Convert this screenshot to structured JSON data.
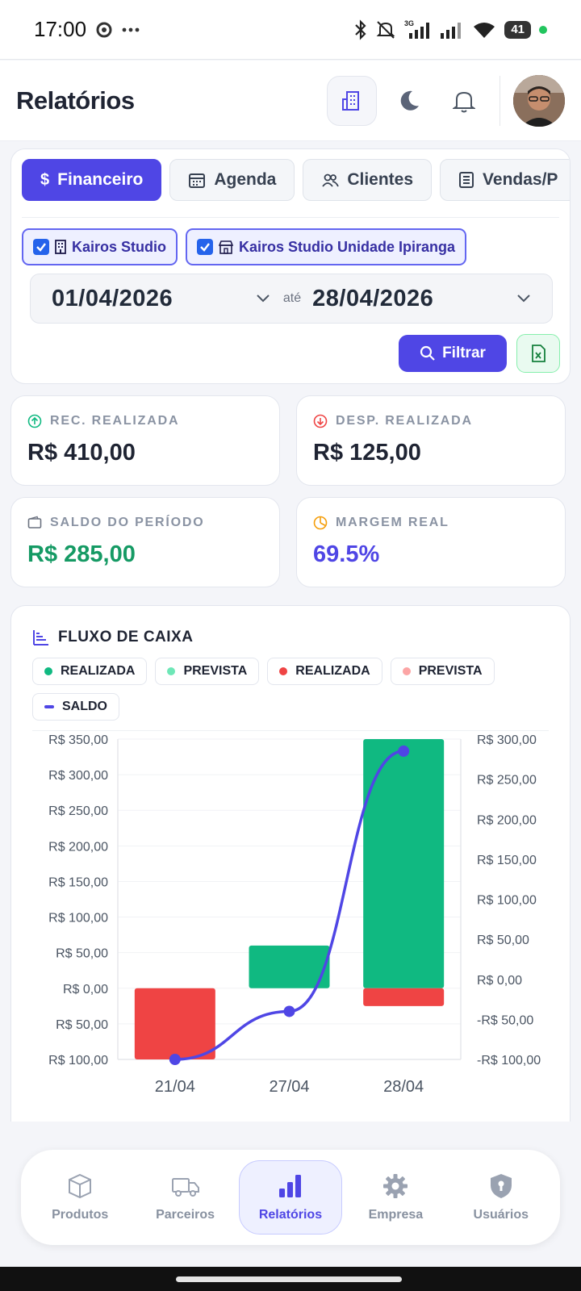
{
  "status_bar": {
    "time": "17:00",
    "battery": "41",
    "network": "3G"
  },
  "header": {
    "title": "Relatórios"
  },
  "tabs": [
    {
      "label": "Financeiro",
      "icon": "dollar-icon"
    },
    {
      "label": "Agenda",
      "icon": "calendar-icon"
    },
    {
      "label": "Clientes",
      "icon": "users-icon"
    },
    {
      "label": "Vendas/P",
      "icon": "receipt-icon"
    }
  ],
  "filters": {
    "units": [
      {
        "label": "Kairos Studio",
        "checked": true,
        "icon": "building-icon"
      },
      {
        "label": "Kairos Studio Unidade Ipiranga",
        "checked": true,
        "icon": "store-icon"
      }
    ],
    "date_from": "01/04/2026",
    "date_separator": "até",
    "date_to": "28/04/2026",
    "filter_button": "Filtrar"
  },
  "kpis": [
    {
      "label": "REC. REALIZADA",
      "value": "R$ 410,00",
      "icon": "arrow-up-circle-icon"
    },
    {
      "label": "DESP. REALIZADA",
      "value": "R$ 125,00",
      "icon": "arrow-down-circle-icon"
    },
    {
      "label": "SALDO DO PERÍODO",
      "value": "R$ 285,00",
      "icon": "wallet-icon"
    },
    {
      "label": "MARGEM REAL",
      "value": "69.5%",
      "icon": "pie-chart-icon"
    }
  ],
  "chart_card": {
    "title": "FLUXO DE CAIXA",
    "legend": [
      {
        "label": "REALIZADA",
        "color": "#10b981",
        "shape": "dot"
      },
      {
        "label": "PREVISTA",
        "color": "#6ee7b7",
        "shape": "dot"
      },
      {
        "label": "REALIZADA",
        "color": "#ef4444",
        "shape": "dot"
      },
      {
        "label": "PREVISTA",
        "color": "#fca5a5",
        "shape": "dot"
      },
      {
        "label": "SALDO",
        "color": "#4f46e5",
        "shape": "line"
      }
    ]
  },
  "chart_data": {
    "type": "bar",
    "title": "FLUXO DE CAIXA",
    "categories": [
      "21/04",
      "27/04",
      "28/04"
    ],
    "y_left_ticks": [
      "R$ 350,00",
      "R$ 300,00",
      "R$ 250,00",
      "R$ 200,00",
      "R$ 150,00",
      "R$ 100,00",
      "R$ 50,00",
      "R$ 0,00",
      "R$ 50,00",
      "R$ 100,00"
    ],
    "y_right_ticks": [
      "R$ 300,00",
      "R$ 250,00",
      "R$ 200,00",
      "R$ 150,00",
      "R$ 100,00",
      "R$ 50,00",
      "R$ 0,00",
      "-R$ 50,00",
      "-R$ 100,00"
    ],
    "ylim_left": [
      -100,
      350
    ],
    "ylim_right": [
      -100,
      300
    ],
    "series": [
      {
        "name": "REALIZADA",
        "kind": "bar",
        "color": "#10b981",
        "values": [
          0,
          60,
          350
        ]
      },
      {
        "name": "REALIZADA",
        "kind": "bar",
        "color": "#ef4444",
        "values": [
          -100,
          0,
          -25
        ]
      },
      {
        "name": "SALDO",
        "kind": "line",
        "axis": "right",
        "color": "#4f46e5",
        "values": [
          -100,
          -40,
          285
        ]
      }
    ]
  },
  "bottom_nav": [
    {
      "label": "Produtos",
      "icon": "box-icon",
      "active": false
    },
    {
      "label": "Parceiros",
      "icon": "truck-icon",
      "active": false
    },
    {
      "label": "Relatórios",
      "icon": "bar-chart-icon",
      "active": true
    },
    {
      "label": "Empresa",
      "icon": "gear-icon",
      "active": false
    },
    {
      "label": "Usuários",
      "icon": "shield-icon",
      "active": false
    }
  ]
}
